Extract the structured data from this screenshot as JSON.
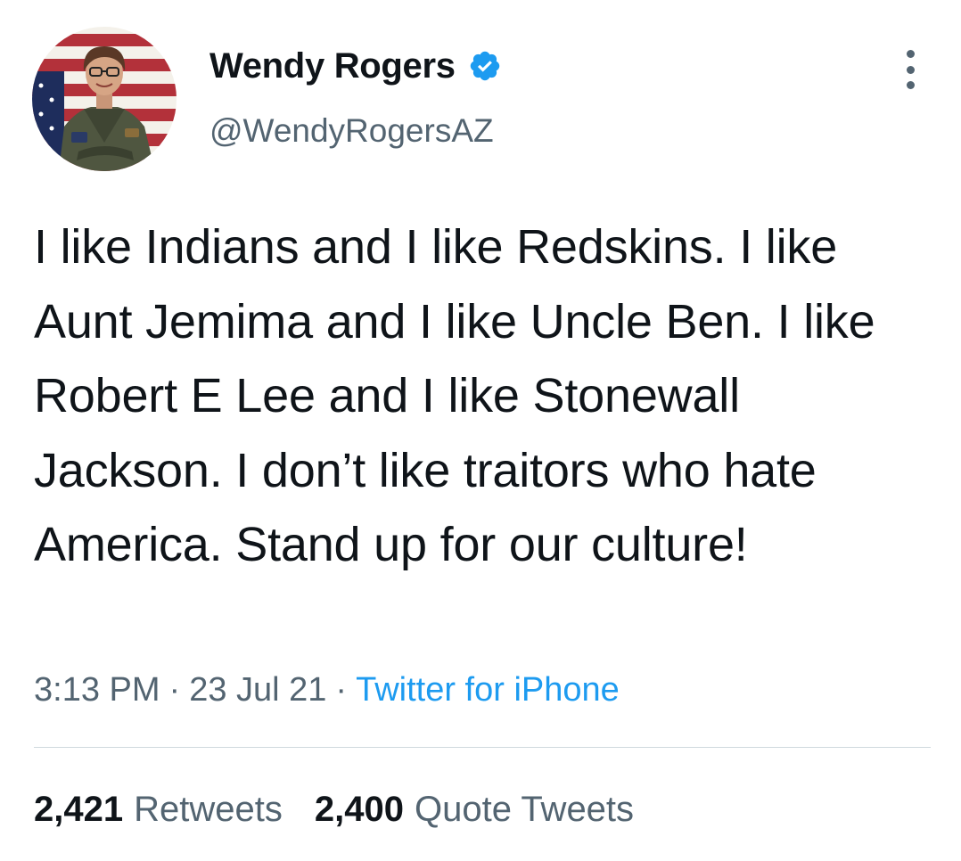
{
  "tweet": {
    "author": {
      "display_name": "Wendy Rogers",
      "handle": "@WendyRogersAZ",
      "verified": true,
      "avatar_icon": "profile-photo"
    },
    "text": "I like Indians and I like Redskins. I like Aunt Jemima and I like Uncle Ben. I like Robert E Lee and I like Stonewall Jackson. I don’t like traitors who hate America. Stand up for our culture!",
    "time": "3:13 PM",
    "date": "23 Jul 21",
    "separator": "·",
    "source": "Twitter for iPhone",
    "stats": {
      "retweets_count": "2,421",
      "retweets_label": "Retweets",
      "quote_tweets_count": "2,400",
      "quote_tweets_label": "Quote Tweets"
    }
  },
  "colors": {
    "primary_text": "#0f1419",
    "secondary_text": "#536471",
    "link": "#1d9bf0",
    "verified_badge": "#1d9bf0",
    "divider": "#cfd9de"
  },
  "icons": {
    "verified": "verified-badge-icon",
    "more": "more-options-icon"
  }
}
